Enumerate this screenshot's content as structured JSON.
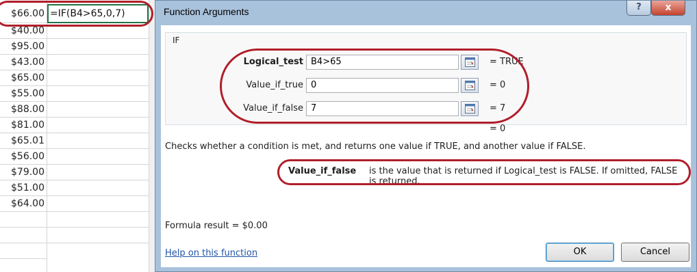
{
  "sheet": {
    "active_cell_value": "$66.00",
    "formula": "=IF(B4>65,0,7)",
    "column_values": [
      "$40.00",
      "$95.00",
      "$43.00",
      "$65.00",
      "$55.00",
      "$88.00",
      "$81.00",
      "$65.01",
      "$56.00",
      "$79.00",
      "$51.00",
      "$64.00"
    ]
  },
  "dialog": {
    "title": "Function Arguments",
    "help_glyph": "?",
    "close_glyph": "x",
    "function_name": "IF",
    "arguments": [
      {
        "label": "Logical_test",
        "value": "B4>65",
        "result": "=  TRUE"
      },
      {
        "label": "Value_if_true",
        "value": "0",
        "result": "=  0"
      },
      {
        "label": "Value_if_false",
        "value": "7",
        "result": "=  7"
      }
    ],
    "overall_result": "=  0",
    "description": "Checks whether a condition is met, and returns one value if TRUE, and another value if FALSE.",
    "arg_description_name": "Value_if_false",
    "arg_description_text": "is the value that is returned if Logical_test is FALSE. If omitted, FALSE is returned.",
    "formula_result": "Formula result =   $0.00",
    "help_link": "Help on this function",
    "ok_label": "OK",
    "cancel_label": "Cancel"
  },
  "colors": {
    "annotation_red": "#b01e2a",
    "frame_blue": "#a9c2dc",
    "link_blue": "#1f55a4",
    "cell_border_green": "#217346"
  },
  "icons": {
    "collapse": "collapse-dialog-icon"
  }
}
